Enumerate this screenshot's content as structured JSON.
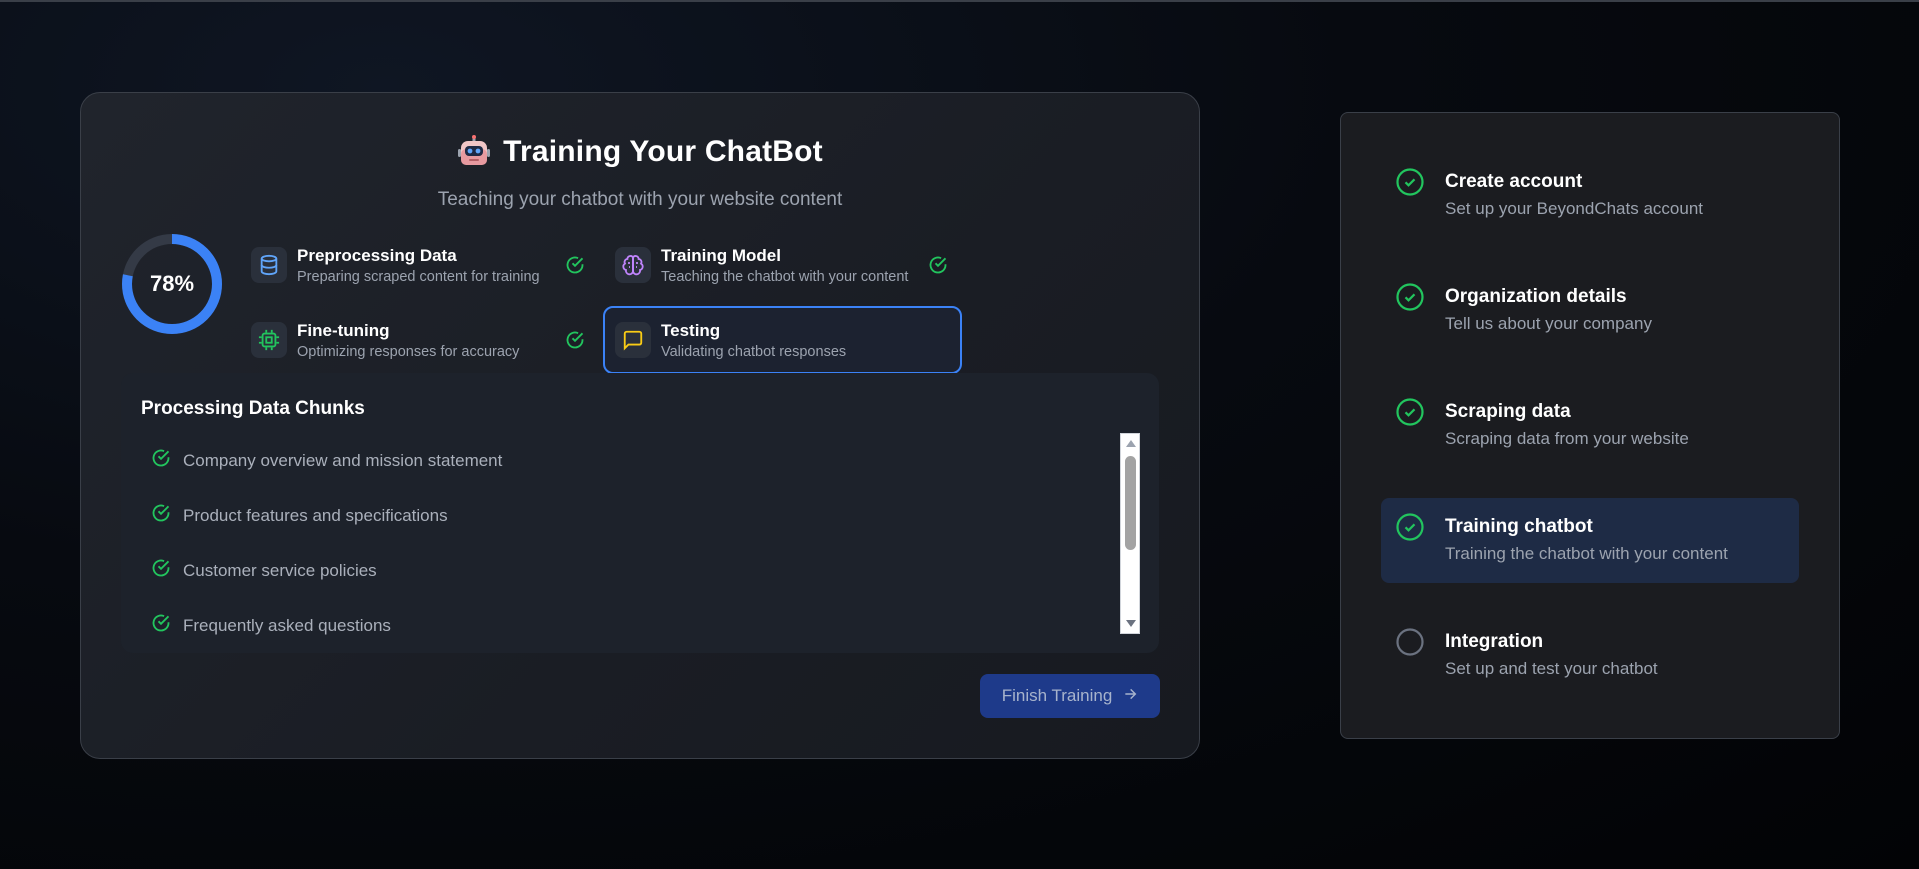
{
  "header": {
    "title": "Training Your ChatBot",
    "subtitle": "Teaching your chatbot with your website content"
  },
  "progress": {
    "percent_label": "78%",
    "value": 0.78
  },
  "stages": [
    {
      "name": "Preprocessing Data",
      "description": "Preparing scraped content for training",
      "icon": "database-icon",
      "status": "complete"
    },
    {
      "name": "Training Model",
      "description": "Teaching the chatbot with your content",
      "icon": "brain-icon",
      "status": "complete"
    },
    {
      "name": "Fine-tuning",
      "description": "Optimizing responses for accuracy",
      "icon": "cpu-icon",
      "status": "complete"
    },
    {
      "name": "Testing",
      "description": "Validating chatbot responses",
      "icon": "message-square-icon",
      "status": "active"
    }
  ],
  "chunks": {
    "title": "Processing Data Chunks",
    "items": [
      "Company overview and mission statement",
      "Product features and specifications",
      "Customer service policies",
      "Frequently asked questions"
    ]
  },
  "finish_button": {
    "label": "Finish Training"
  },
  "steps": [
    {
      "name": "Create account",
      "description": "Set up your BeyondChats account",
      "status": "complete"
    },
    {
      "name": "Organization details",
      "description": "Tell us about your company",
      "status": "complete"
    },
    {
      "name": "Scraping data",
      "description": "Scraping data from your website",
      "status": "complete"
    },
    {
      "name": "Training chatbot",
      "description": "Training the chatbot with your content",
      "status": "active"
    },
    {
      "name": "Integration",
      "description": "Set up and test your chatbot",
      "status": "pending"
    }
  ],
  "colors": {
    "accent": "#3b82f6",
    "success": "#22c55e",
    "background": "#05070b",
    "card": "#1b1e25",
    "active_step": "#1e2b45",
    "button": "#1e3a8a"
  }
}
